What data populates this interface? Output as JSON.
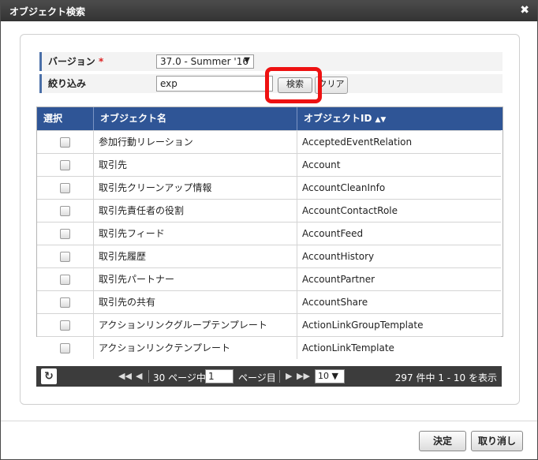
{
  "dialog": {
    "title": "オブジェクト検索",
    "close_icon": "close-icon",
    "close_glyph": "✖"
  },
  "form": {
    "version_label": "バージョン",
    "required_mark": "*",
    "version_value": "37.0 - Summer '16",
    "filter_label": "絞り込み",
    "filter_value": "exp",
    "search_button": "検索",
    "clear_button": "クリア"
  },
  "grid": {
    "headers": {
      "select": "選択",
      "name": "オブジェクト名",
      "id": "オブジェクトID"
    },
    "rows": [
      {
        "name": "参加行動リレーション",
        "id": "AcceptedEventRelation"
      },
      {
        "name": "取引先",
        "id": "Account"
      },
      {
        "name": "取引先クリーンアップ情報",
        "id": "AccountCleanInfo"
      },
      {
        "name": "取引先責任者の役割",
        "id": "AccountContactRole"
      },
      {
        "name": "取引先フィード",
        "id": "AccountFeed"
      },
      {
        "name": "取引先履歴",
        "id": "AccountHistory"
      },
      {
        "name": "取引先パートナー",
        "id": "AccountPartner"
      },
      {
        "name": "取引先の共有",
        "id": "AccountShare"
      },
      {
        "name": "アクションリンクグループテンプレート",
        "id": "ActionLinkGroupTemplate"
      },
      {
        "name": "アクションリンクテンプレート",
        "id": "ActionLinkTemplate"
      }
    ]
  },
  "pager": {
    "pages_label": "30 ページ中",
    "page_value": "1",
    "page_suffix": "ページ目",
    "page_size": "10",
    "summary": "297 件中 1 - 10 を表示"
  },
  "footer": {
    "ok_button": "決定",
    "cancel_button": "取り消し"
  },
  "colors": {
    "highlight": "#e11111",
    "grid_header": "#2f5596"
  }
}
